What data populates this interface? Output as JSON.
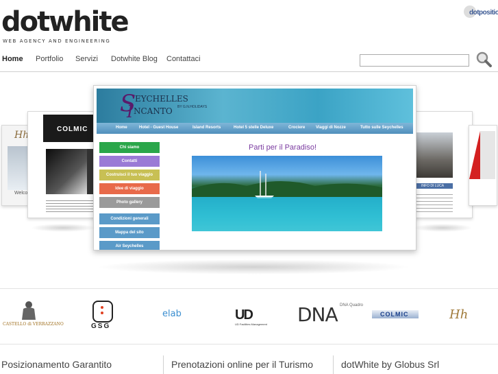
{
  "brand": {
    "logo": "dotwhite",
    "tagline": "WEB AGENCY AND ENGINEERING",
    "partner_logo": "dotposition"
  },
  "nav": {
    "items": [
      "Home",
      "Portfolio",
      "Servizi",
      "Dotwhite Blog",
      "Contattaci"
    ],
    "active": "Home"
  },
  "search": {
    "value": "",
    "placeholder": ""
  },
  "showcase": {
    "main": {
      "site_title_1": "EYCHELLES",
      "site_title_2": "NCANTO",
      "site_initial_1": "S",
      "site_initial_2": "I",
      "site_byline": "BY G.N.HOLIDAYS",
      "menu": [
        "Home",
        "Hotel - Guest House",
        "Island Resorts",
        "Hotel 5 stelle Deluxe",
        "Crociere",
        "Viaggi di Nozze",
        "Tutto sulle Seychelles"
      ],
      "sidebar": [
        "Chi siamo",
        "Contatti",
        "Costruisci il tuo viaggio",
        "Idee di viaggio",
        "Photo gallery",
        "Condizioni generali",
        "Mappa del sito",
        "Air Seychelles"
      ],
      "heading": "Parti per il Paradiso!"
    },
    "left_thumb_brand": "COLMIC",
    "left_far_brand": "Hh",
    "left_far_text": "Welco",
    "right_thumb_label": "INFO DI LUCA"
  },
  "clients": [
    "CASTELLO di VERRAZZANO",
    "GSG",
    "elab",
    "UD Facilities Management",
    "DNA Quadro",
    "COLMIC",
    "Hh"
  ],
  "footer": [
    "Posizionamento Garantito",
    "Prenotazioni online per il Turismo",
    "dotWhite by Globus Srl"
  ],
  "colors": {
    "accent_red": "#c8102e",
    "menu_blue": "#4f8fbc",
    "heading_purple": "#7a3aa0",
    "partner_blue": "#3d5a94"
  }
}
